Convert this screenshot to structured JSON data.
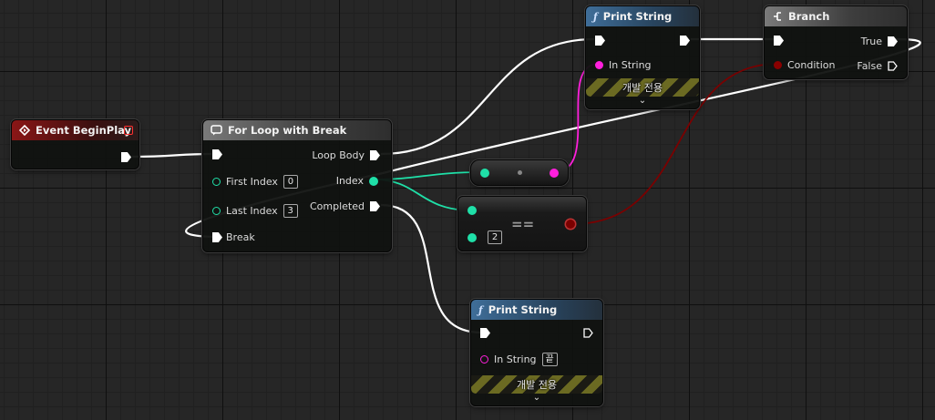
{
  "nodes": {
    "event_begin_play": {
      "title": "Event BeginPlay"
    },
    "for_loop": {
      "title": "For Loop with Break",
      "first_index_label": "First Index",
      "first_index_value": "0",
      "last_index_label": "Last Index",
      "last_index_value": "3",
      "break_label": "Break",
      "loop_body_label": "Loop Body",
      "index_label": "Index",
      "completed_label": "Completed"
    },
    "print_string_top": {
      "title": "Print String",
      "in_string_label": "In String",
      "dev_only_label": "개발 전용"
    },
    "branch": {
      "title": "Branch",
      "condition_label": "Condition",
      "true_label": "True",
      "false_label": "False"
    },
    "equal_node": {
      "operator": "==",
      "value": "2"
    },
    "print_string_bottom": {
      "title": "Print String",
      "in_string_label": "In String",
      "in_string_value": "끝",
      "dev_only_label": "개발 전용"
    }
  },
  "colors": {
    "exec_wire": "#ffffff",
    "integer_pin": "#1fe0a8",
    "string_pin": "#ff1fdc",
    "boolean_pin": "#9a0000",
    "event_header": "#8a1616",
    "function_header": "#3f6e99",
    "macro_header": "#7a7a7a"
  },
  "icons": {
    "event": "diamond-arrow-icon",
    "for_loop": "loop-icon",
    "function": "function-f-icon",
    "branch": "branch-icon",
    "dev_expand": "chevron-down-icon"
  }
}
